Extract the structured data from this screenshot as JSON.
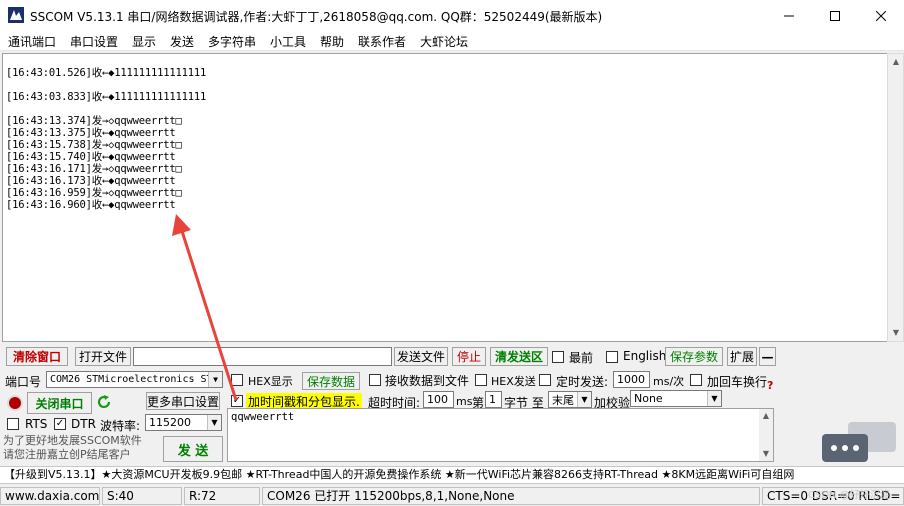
{
  "window": {
    "title": "SSCOM V5.13.1 串口/网络数据调试器,作者:大虾丁丁,2618058@qq.com. QQ群：52502449(最新版本)",
    "minimize_icon": "minimize-icon",
    "maximize_icon": "maximize-icon",
    "close_icon": "close-icon"
  },
  "menu": [
    "通讯端口",
    "串口设置",
    "显示",
    "发送",
    "多字符串",
    "小工具",
    "帮助",
    "联系作者",
    "大虾论坛"
  ],
  "receive_log": [
    "[16:43:01.526]收←◆111111111111111",
    "[16:43:03.833]收←◆111111111111111",
    "[16:43:13.374]发→◇qqwweerrtt□",
    "[16:43:13.375]收←◆qqwweerrtt",
    "[16:43:15.738]发→◇qqwweerrtt□",
    "[16:43:15.740]收←◆qqwweerrtt",
    "[16:43:16.171]发→◇qqwweerrtt□",
    "[16:43:16.173]收←◆qqwweerrtt",
    "[16:43:16.959]发→◇qqwweerrtt□",
    "[16:43:16.960]收←◆qqwweerrtt"
  ],
  "watermark": "CSDN @好好沉淀",
  "toolbar": {
    "clear_window": "清除窗口",
    "open_file": "打开文件",
    "file_path": "",
    "send_file": "发送文件",
    "stop": "停止",
    "clear_send": "清发送区",
    "topmost": "最前",
    "english": "English",
    "save_params": "保存参数",
    "expand": "扩展",
    "collapse": "—"
  },
  "settings": {
    "port_label": "端口号",
    "port_value": "COM26 STMicroelectronics ST",
    "hex_display": "HEX显示",
    "save_data": "保存数据",
    "recv_to_file": "接收数据到文件",
    "hex_send": "HEX发送",
    "timed_send": "定时发送:",
    "timed_interval": "1000",
    "timed_unit": "ms/次",
    "add_crlf": "加回车换行",
    "help_mark": "?",
    "close_port": "关闭串口",
    "refresh_icon": "refresh-icon",
    "more_settings": "更多串口设置",
    "add_timestamp": "加时间戳和分包显示.",
    "timeout_label": "超时时间:",
    "timeout_value": "100",
    "timeout_unit": "ms",
    "nth_label": "第",
    "byte_index": "1",
    "byte_label": "字节 至",
    "end_value": "末尾",
    "checksum_label": "加校验",
    "checksum_value": "None",
    "rts": "RTS",
    "dtr": "DTR",
    "baud_label": "波特率:",
    "baud_value": "115200",
    "promo_text": "为了更好地发展SSCOM软件\n请您注册嘉立创P结尾客户",
    "send_button": "发 送",
    "send_content": "qqwweerrtt"
  },
  "promo_bar": "【升级到V5.13.1】★大资源MCU开发板9.9包邮 ★RT-Thread中国人的开源免费操作系统 ★新一代WiFi芯片兼容8266支持RT-Thread ★8KM远距离WiFi可自组网",
  "status": {
    "url": "www.daxia.com",
    "sent": "S:40",
    "received": "R:72",
    "port_status": "COM26 已打开  115200bps,8,1,None,None",
    "lines": "CTS=0 DSR=0 RLSD="
  },
  "colors": {
    "accent_green": "#008000",
    "accent_red": "#c00000",
    "highlight_yellow": "#ffff00",
    "annotation_red": "#e8443a"
  }
}
